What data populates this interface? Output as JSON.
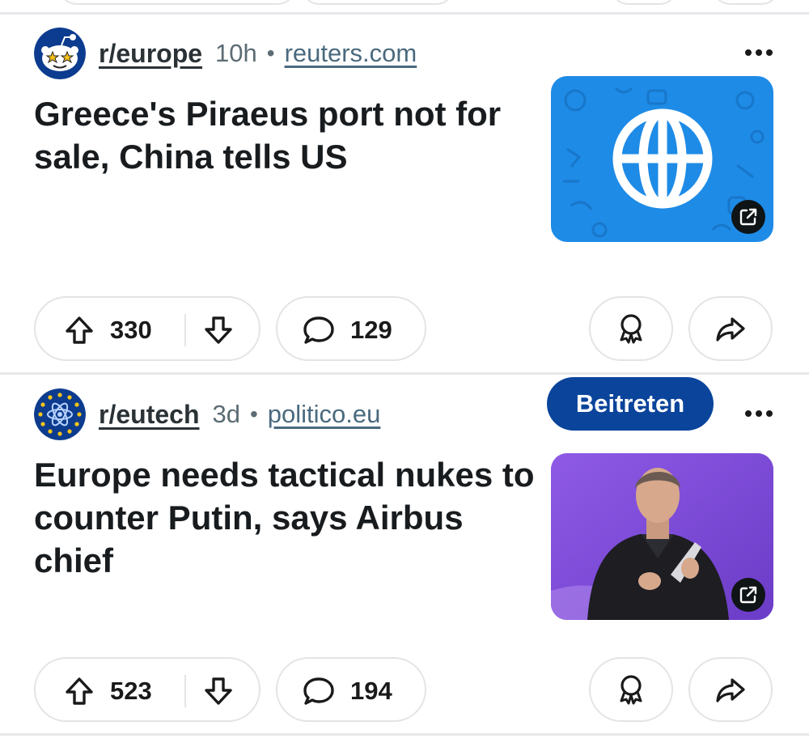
{
  "feed": {
    "posts": [
      {
        "subreddit": "r/europe",
        "age": "10h",
        "separator": "•",
        "domain": "reuters.com",
        "title": "Greece's Piraeus port not for sale, China tells US",
        "upvotes": "330",
        "comments": "129",
        "avatar_icon": "reddit-snoo-star-eyes",
        "thumbnail_icon": "globe-icon",
        "thumbnail_color": "#1e8be6"
      },
      {
        "subreddit": "r/eutech",
        "age": "3d",
        "separator": "•",
        "domain": "politico.eu",
        "join_label": "Beitreten",
        "title": "Europe needs tactical nukes to counter Putin, says Airbus chief",
        "upvotes": "523",
        "comments": "194",
        "avatar_icon": "eu-atom-icon",
        "thumbnail_icon": "speaker-photo",
        "thumbnail_color": "#7c4ad6"
      }
    ]
  },
  "colors": {
    "join_button": "#0a449b",
    "separator": "#e6e8ea"
  }
}
